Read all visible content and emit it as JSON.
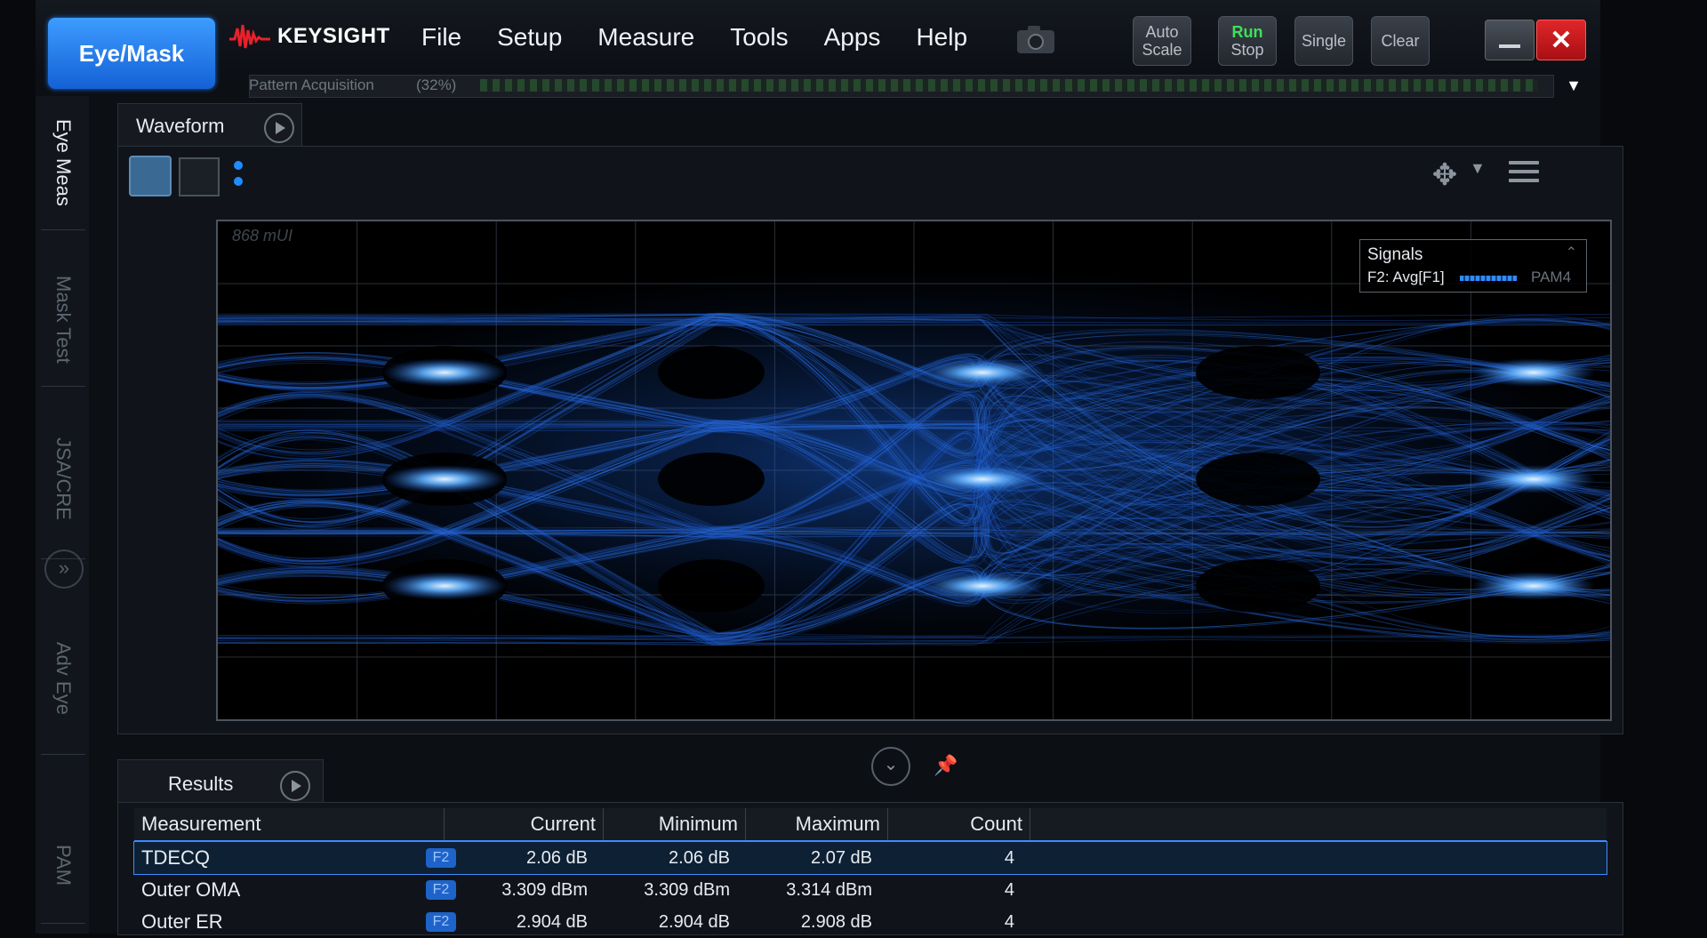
{
  "app": {
    "mode_button": "Eye/Mask",
    "brand": "KEYSIGHT",
    "menu": [
      "File",
      "Setup",
      "Measure",
      "Tools",
      "Apps",
      "Help"
    ],
    "toolbar": {
      "auto_scale": [
        "Auto",
        "Scale"
      ],
      "run_stop": [
        "Run",
        "Stop"
      ],
      "single": "Single",
      "clear": "Clear"
    },
    "close_label": "✕",
    "acquisition": {
      "label": "Pattern Acquisition",
      "percent": "(32%)",
      "progress": 0.32
    },
    "colors": {
      "accent": "#1f8cff",
      "run_green": "#3ee05a",
      "close_red": "#d3181c",
      "trace_blue": "#2f7dff"
    }
  },
  "side_tabs": [
    "Eye Meas",
    "Mask Test",
    "JSA/CRE",
    "Adv Eye",
    "PAM"
  ],
  "side_expand_label": "»",
  "waveform": {
    "tab_label": "Waveform",
    "scale_label": "868 mUI",
    "signals": {
      "title": "Signals",
      "name": "F2: Avg[F1]",
      "type": "PAM4"
    },
    "marker_label": "F2"
  },
  "results": {
    "tab_label": "Results",
    "columns": [
      "Measurement",
      "Current",
      "Minimum",
      "Maximum",
      "Count"
    ],
    "rows": [
      {
        "name": "TDECQ",
        "badge": "F2",
        "current": "2.06 dB",
        "minimum": "2.06 dB",
        "maximum": "2.07 dB",
        "count": "4"
      },
      {
        "name": "Outer OMA",
        "badge": "F2",
        "current": "3.309 dBm",
        "minimum": "3.309 dBm",
        "maximum": "3.314 dBm",
        "count": "4"
      },
      {
        "name": "Outer ER",
        "badge": "F2",
        "current": "2.904 dB",
        "minimum": "2.904 dB",
        "maximum": "2.908 dB",
        "count": "4"
      }
    ]
  }
}
